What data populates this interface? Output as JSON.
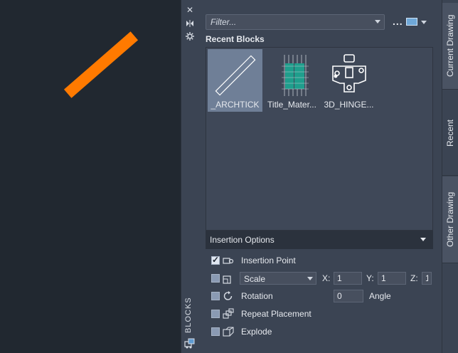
{
  "strip": {
    "title": "BLOCKS"
  },
  "toolbar": {
    "filter_placeholder": "Filter...",
    "more_label": "..."
  },
  "recent": {
    "section_title": "Recent Blocks",
    "blocks": [
      {
        "name": "_ARCHTICK",
        "selected": true
      },
      {
        "name": "Title_Mater...",
        "selected": false
      },
      {
        "name": "3D_HINGE...",
        "selected": false
      }
    ]
  },
  "insertion": {
    "header": "Insertion Options",
    "insertion_point": {
      "label": "Insertion Point",
      "checked": true
    },
    "scale": {
      "checked": false,
      "select_value": "Scale",
      "x_label": "X:",
      "x_value": "1",
      "y_label": "Y:",
      "y_value": "1",
      "z_label": "Z:",
      "z_value": "1"
    },
    "rotation": {
      "label": "Rotation",
      "checked": false,
      "angle_value": "0",
      "angle_label": "Angle"
    },
    "repeat_placement": {
      "label": "Repeat Placement",
      "checked": false
    },
    "explode": {
      "label": "Explode",
      "checked": false
    }
  },
  "tabs": [
    {
      "label": "Current Drawing",
      "active": false
    },
    {
      "label": "Recent",
      "active": true
    },
    {
      "label": "Other Drawing",
      "active": false
    }
  ],
  "colors": {
    "background": "#212830",
    "panel": "#3b4453",
    "selection": "#6f7f97",
    "accent_orange": "#ff7a00"
  }
}
